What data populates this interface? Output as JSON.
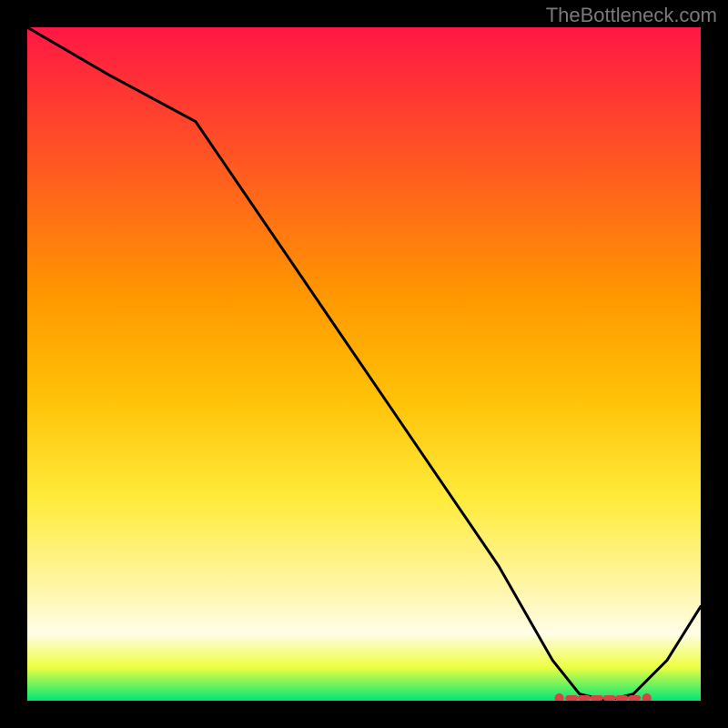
{
  "attribution": "TheBottleneck.com",
  "chart_data": {
    "type": "line",
    "title": "",
    "xlabel": "",
    "ylabel": "",
    "xlim": [
      0,
      100
    ],
    "ylim": [
      0,
      100
    ],
    "x": [
      0,
      12,
      25,
      40,
      55,
      70,
      78,
      82,
      86,
      90,
      95,
      100
    ],
    "values": [
      100,
      93,
      86,
      64,
      42,
      20,
      6,
      1,
      0,
      1,
      6,
      14
    ],
    "optimal_band": {
      "x_start": 79,
      "x_end": 92,
      "y": 0
    },
    "gradient_stops": [
      {
        "offset": 0.0,
        "color": "#ff1744"
      },
      {
        "offset": 0.2,
        "color": "#ff5722"
      },
      {
        "offset": 0.4,
        "color": "#ff9800"
      },
      {
        "offset": 0.55,
        "color": "#ffc107"
      },
      {
        "offset": 0.7,
        "color": "#ffeb3b"
      },
      {
        "offset": 0.82,
        "color": "#fff59d"
      },
      {
        "offset": 0.9,
        "color": "#fffde7"
      },
      {
        "offset": 0.95,
        "color": "#eeff41"
      },
      {
        "offset": 1.0,
        "color": "#00e676"
      }
    ]
  }
}
